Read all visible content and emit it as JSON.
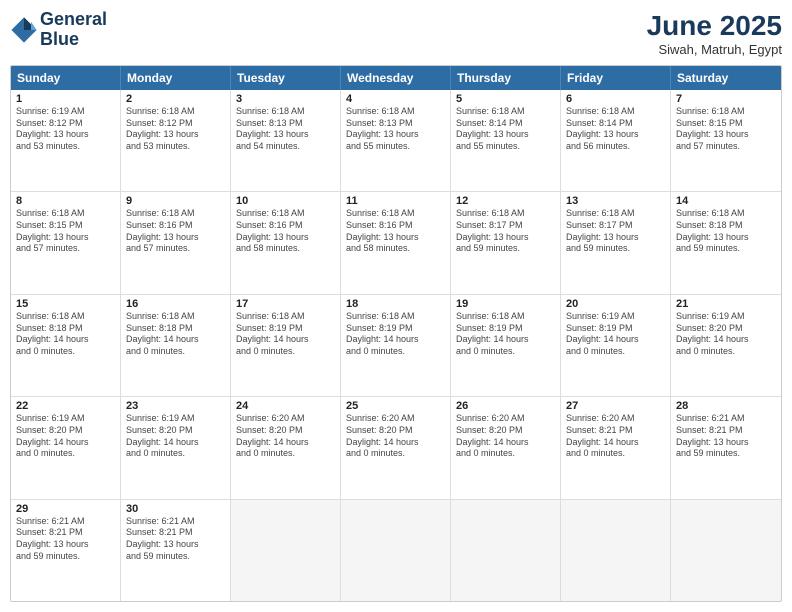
{
  "header": {
    "logo_line1": "General",
    "logo_line2": "Blue",
    "month": "June 2025",
    "location": "Siwah, Matruh, Egypt"
  },
  "days_of_week": [
    "Sunday",
    "Monday",
    "Tuesday",
    "Wednesday",
    "Thursday",
    "Friday",
    "Saturday"
  ],
  "weeks": [
    [
      {
        "day": "1",
        "lines": [
          "Sunrise: 6:19 AM",
          "Sunset: 8:12 PM",
          "Daylight: 13 hours",
          "and 53 minutes."
        ]
      },
      {
        "day": "2",
        "lines": [
          "Sunrise: 6:18 AM",
          "Sunset: 8:12 PM",
          "Daylight: 13 hours",
          "and 53 minutes."
        ]
      },
      {
        "day": "3",
        "lines": [
          "Sunrise: 6:18 AM",
          "Sunset: 8:13 PM",
          "Daylight: 13 hours",
          "and 54 minutes."
        ]
      },
      {
        "day": "4",
        "lines": [
          "Sunrise: 6:18 AM",
          "Sunset: 8:13 PM",
          "Daylight: 13 hours",
          "and 55 minutes."
        ]
      },
      {
        "day": "5",
        "lines": [
          "Sunrise: 6:18 AM",
          "Sunset: 8:14 PM",
          "Daylight: 13 hours",
          "and 55 minutes."
        ]
      },
      {
        "day": "6",
        "lines": [
          "Sunrise: 6:18 AM",
          "Sunset: 8:14 PM",
          "Daylight: 13 hours",
          "and 56 minutes."
        ]
      },
      {
        "day": "7",
        "lines": [
          "Sunrise: 6:18 AM",
          "Sunset: 8:15 PM",
          "Daylight: 13 hours",
          "and 57 minutes."
        ]
      }
    ],
    [
      {
        "day": "8",
        "lines": [
          "Sunrise: 6:18 AM",
          "Sunset: 8:15 PM",
          "Daylight: 13 hours",
          "and 57 minutes."
        ]
      },
      {
        "day": "9",
        "lines": [
          "Sunrise: 6:18 AM",
          "Sunset: 8:16 PM",
          "Daylight: 13 hours",
          "and 57 minutes."
        ]
      },
      {
        "day": "10",
        "lines": [
          "Sunrise: 6:18 AM",
          "Sunset: 8:16 PM",
          "Daylight: 13 hours",
          "and 58 minutes."
        ]
      },
      {
        "day": "11",
        "lines": [
          "Sunrise: 6:18 AM",
          "Sunset: 8:16 PM",
          "Daylight: 13 hours",
          "and 58 minutes."
        ]
      },
      {
        "day": "12",
        "lines": [
          "Sunrise: 6:18 AM",
          "Sunset: 8:17 PM",
          "Daylight: 13 hours",
          "and 59 minutes."
        ]
      },
      {
        "day": "13",
        "lines": [
          "Sunrise: 6:18 AM",
          "Sunset: 8:17 PM",
          "Daylight: 13 hours",
          "and 59 minutes."
        ]
      },
      {
        "day": "14",
        "lines": [
          "Sunrise: 6:18 AM",
          "Sunset: 8:18 PM",
          "Daylight: 13 hours",
          "and 59 minutes."
        ]
      }
    ],
    [
      {
        "day": "15",
        "lines": [
          "Sunrise: 6:18 AM",
          "Sunset: 8:18 PM",
          "Daylight: 14 hours",
          "and 0 minutes."
        ]
      },
      {
        "day": "16",
        "lines": [
          "Sunrise: 6:18 AM",
          "Sunset: 8:18 PM",
          "Daylight: 14 hours",
          "and 0 minutes."
        ]
      },
      {
        "day": "17",
        "lines": [
          "Sunrise: 6:18 AM",
          "Sunset: 8:19 PM",
          "Daylight: 14 hours",
          "and 0 minutes."
        ]
      },
      {
        "day": "18",
        "lines": [
          "Sunrise: 6:18 AM",
          "Sunset: 8:19 PM",
          "Daylight: 14 hours",
          "and 0 minutes."
        ]
      },
      {
        "day": "19",
        "lines": [
          "Sunrise: 6:18 AM",
          "Sunset: 8:19 PM",
          "Daylight: 14 hours",
          "and 0 minutes."
        ]
      },
      {
        "day": "20",
        "lines": [
          "Sunrise: 6:19 AM",
          "Sunset: 8:19 PM",
          "Daylight: 14 hours",
          "and 0 minutes."
        ]
      },
      {
        "day": "21",
        "lines": [
          "Sunrise: 6:19 AM",
          "Sunset: 8:20 PM",
          "Daylight: 14 hours",
          "and 0 minutes."
        ]
      }
    ],
    [
      {
        "day": "22",
        "lines": [
          "Sunrise: 6:19 AM",
          "Sunset: 8:20 PM",
          "Daylight: 14 hours",
          "and 0 minutes."
        ]
      },
      {
        "day": "23",
        "lines": [
          "Sunrise: 6:19 AM",
          "Sunset: 8:20 PM",
          "Daylight: 14 hours",
          "and 0 minutes."
        ]
      },
      {
        "day": "24",
        "lines": [
          "Sunrise: 6:20 AM",
          "Sunset: 8:20 PM",
          "Daylight: 14 hours",
          "and 0 minutes."
        ]
      },
      {
        "day": "25",
        "lines": [
          "Sunrise: 6:20 AM",
          "Sunset: 8:20 PM",
          "Daylight: 14 hours",
          "and 0 minutes."
        ]
      },
      {
        "day": "26",
        "lines": [
          "Sunrise: 6:20 AM",
          "Sunset: 8:20 PM",
          "Daylight: 14 hours",
          "and 0 minutes."
        ]
      },
      {
        "day": "27",
        "lines": [
          "Sunrise: 6:20 AM",
          "Sunset: 8:21 PM",
          "Daylight: 14 hours",
          "and 0 minutes."
        ]
      },
      {
        "day": "28",
        "lines": [
          "Sunrise: 6:21 AM",
          "Sunset: 8:21 PM",
          "Daylight: 13 hours",
          "and 59 minutes."
        ]
      }
    ],
    [
      {
        "day": "29",
        "lines": [
          "Sunrise: 6:21 AM",
          "Sunset: 8:21 PM",
          "Daylight: 13 hours",
          "and 59 minutes."
        ]
      },
      {
        "day": "30",
        "lines": [
          "Sunrise: 6:21 AM",
          "Sunset: 8:21 PM",
          "Daylight: 13 hours",
          "and 59 minutes."
        ]
      },
      {
        "day": "",
        "lines": []
      },
      {
        "day": "",
        "lines": []
      },
      {
        "day": "",
        "lines": []
      },
      {
        "day": "",
        "lines": []
      },
      {
        "day": "",
        "lines": []
      }
    ]
  ]
}
